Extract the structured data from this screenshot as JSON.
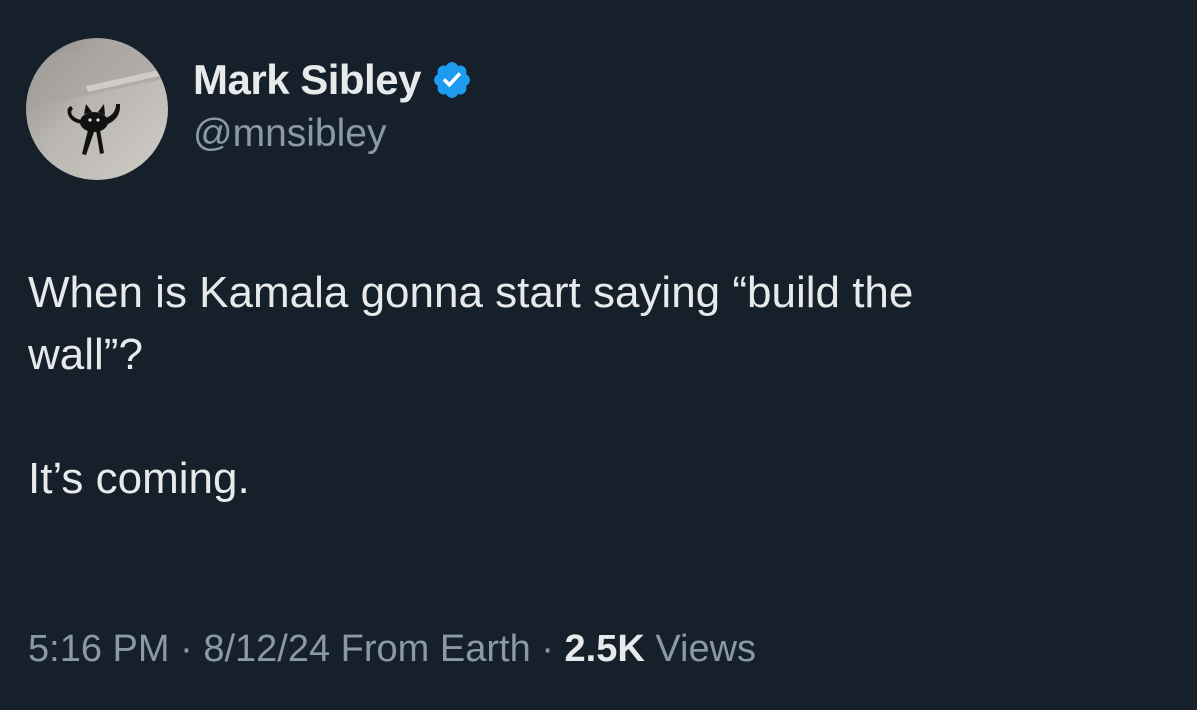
{
  "author": {
    "display_name": "Mark Sibley",
    "handle": "@mnsibley",
    "verified": true,
    "verified_badge_color": "#1d9bf0"
  },
  "tweet": {
    "text_line1": "When is Kamala gonna start saying “build the",
    "text_line2": "wall”?",
    "text_paragraph2": "It’s coming."
  },
  "meta": {
    "time": "5:16 PM",
    "separator1": "·",
    "date": "8/12/24",
    "source": "From Earth",
    "separator2": "·",
    "views_count": "2.5K",
    "views_label": "Views"
  },
  "colors": {
    "background": "#15202b",
    "primary_text": "#e7e9ea",
    "secondary_text": "#8b98a5"
  },
  "icons": {
    "verified": "verified-badge-icon",
    "avatar": "black-cat-avatar"
  }
}
